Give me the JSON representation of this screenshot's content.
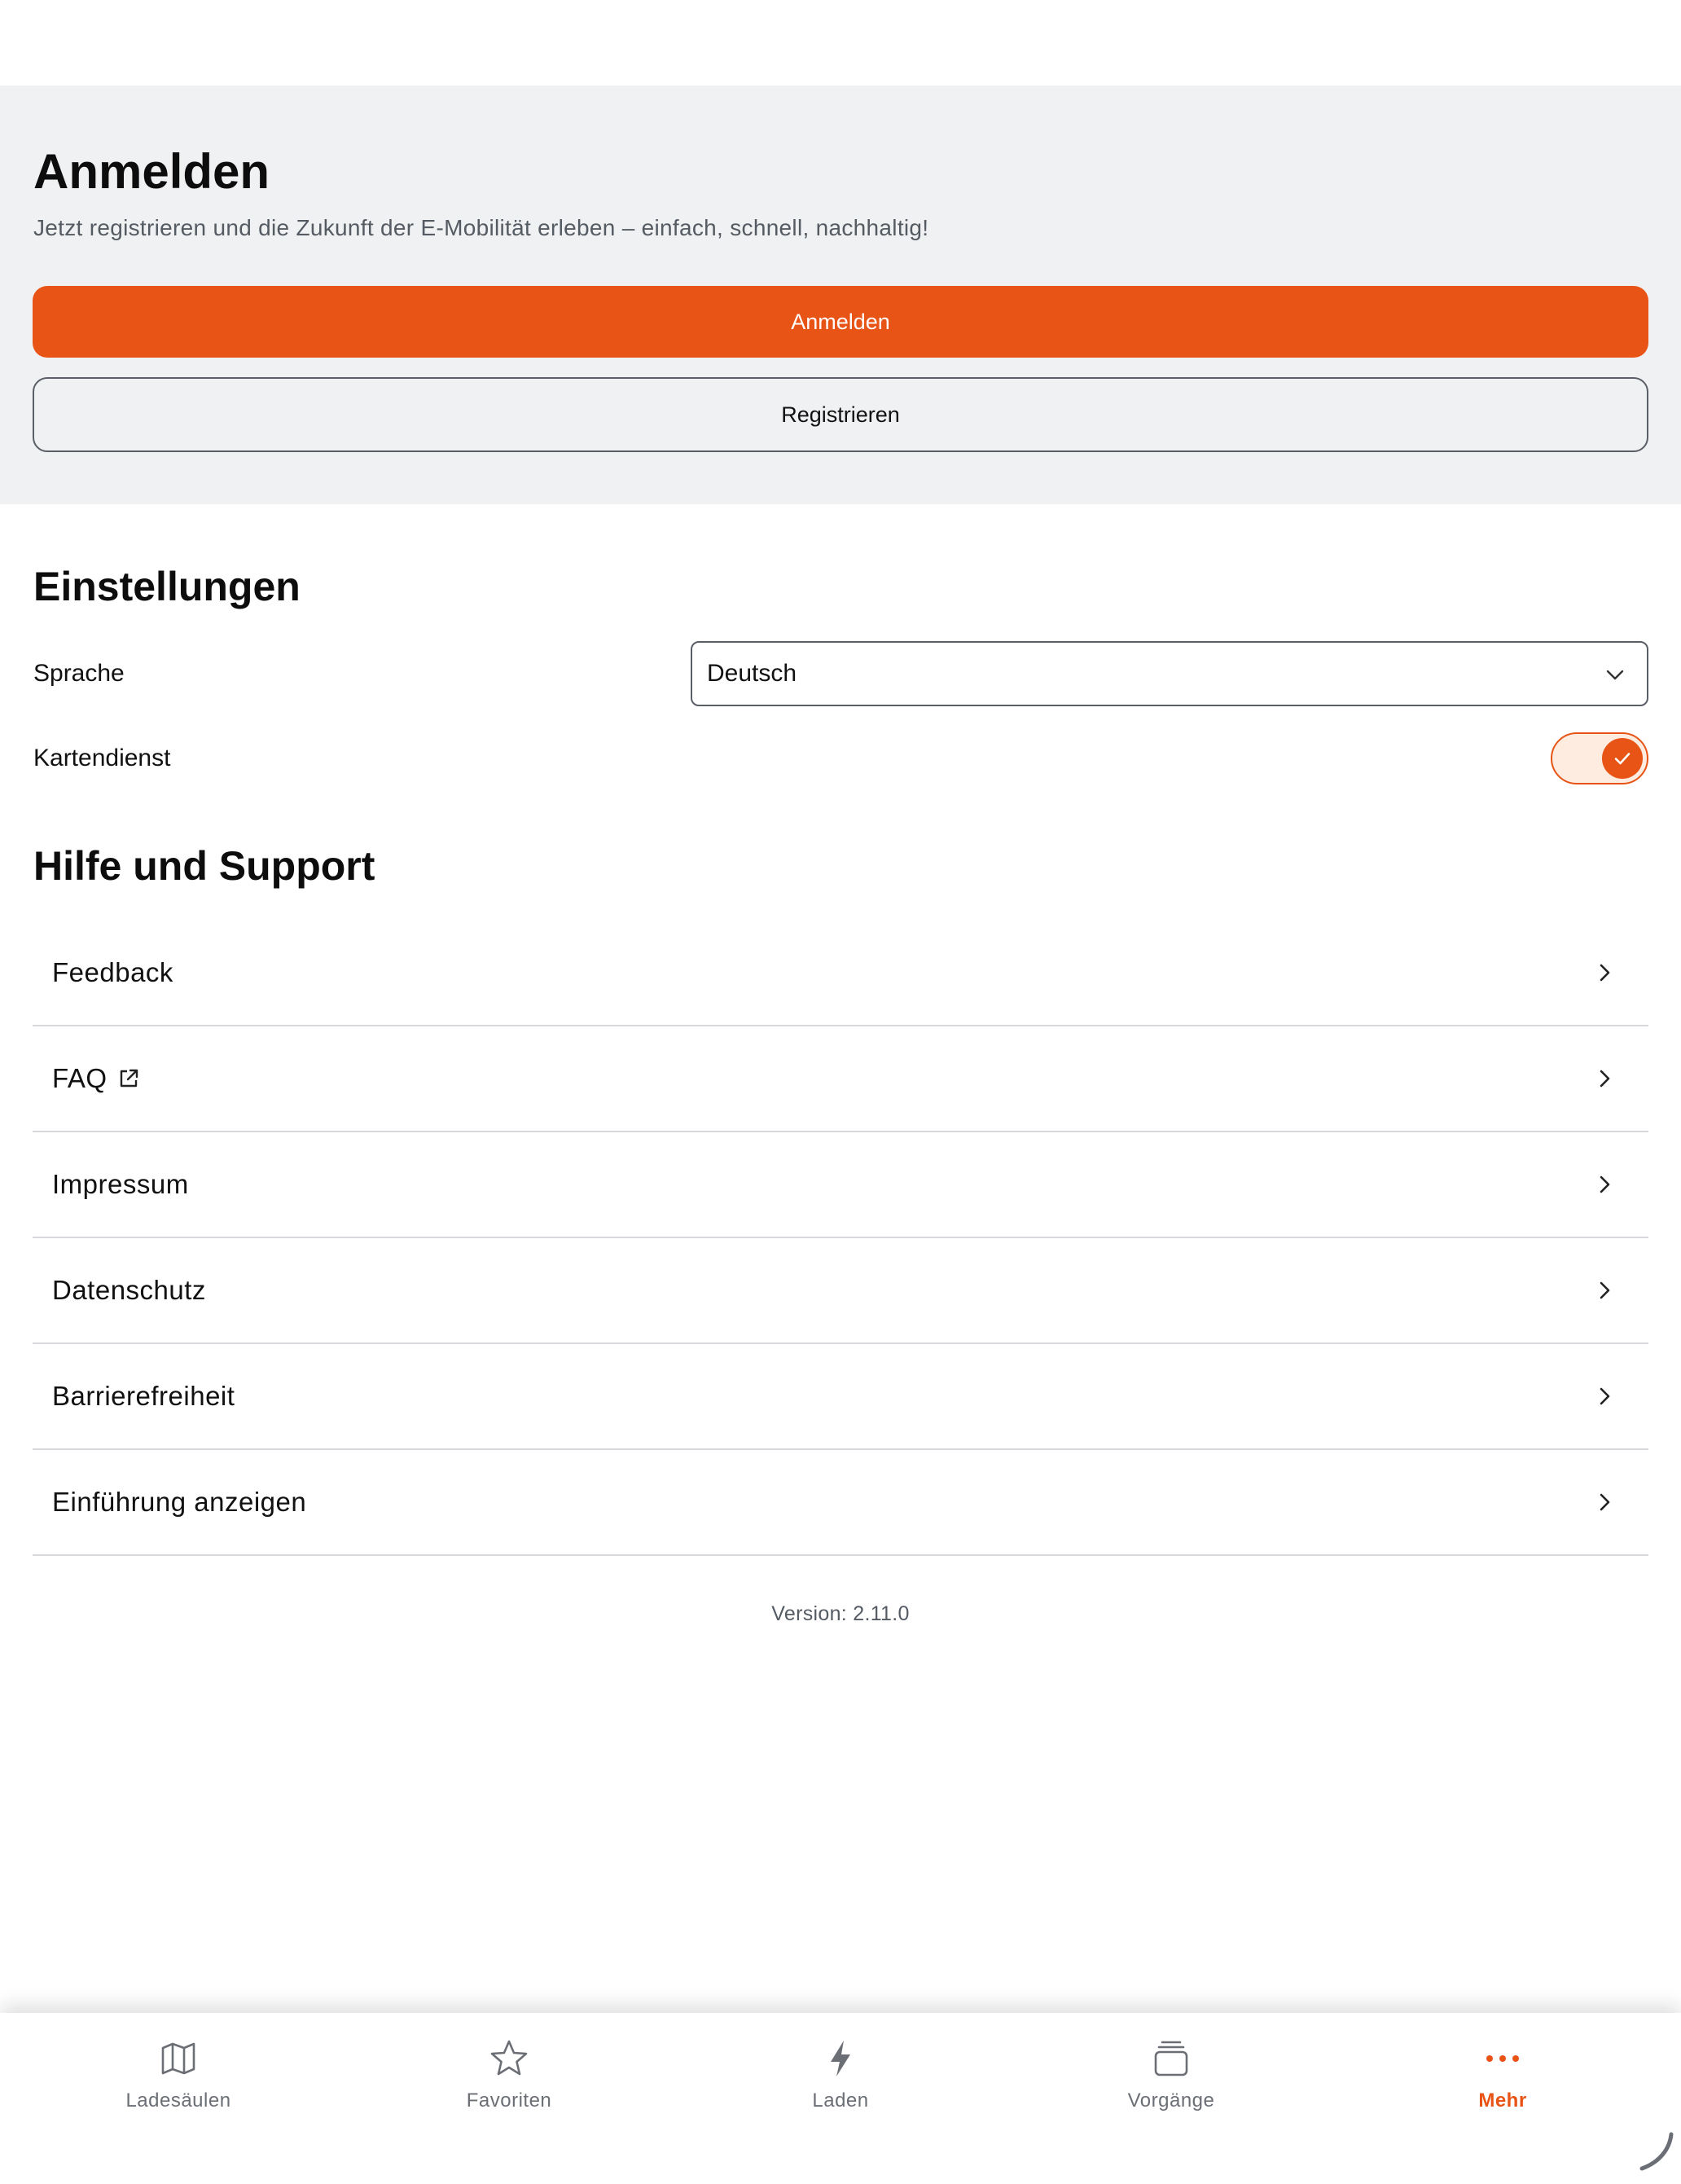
{
  "login": {
    "title": "Anmelden",
    "subtitle": "Jetzt registrieren und die Zukunft der E-Mobilität erleben – einfach, schnell, nachhaltig!",
    "login_button": "Anmelden",
    "register_button": "Registrieren"
  },
  "settings": {
    "title": "Einstellungen",
    "language_label": "Sprache",
    "language_value": "Deutsch",
    "map_service_label": "Kartendienst",
    "map_service_enabled": true
  },
  "help": {
    "title": "Hilfe und Support",
    "items": [
      {
        "label": "Feedback",
        "external": false
      },
      {
        "label": "FAQ",
        "external": true
      },
      {
        "label": "Impressum",
        "external": false
      },
      {
        "label": "Datenschutz",
        "external": false
      },
      {
        "label": "Barrierefreiheit",
        "external": false
      },
      {
        "label": "Einführung anzeigen",
        "external": false
      }
    ]
  },
  "version": "Version: 2.11.0",
  "tabs": [
    {
      "label": "Ladesäulen",
      "icon": "map-icon",
      "active": false
    },
    {
      "label": "Favoriten",
      "icon": "star-icon",
      "active": false
    },
    {
      "label": "Laden",
      "icon": "lightning-icon",
      "active": false
    },
    {
      "label": "Vorgänge",
      "icon": "stack-icon",
      "active": false
    },
    {
      "label": "Mehr",
      "icon": "more-icon",
      "active": true
    }
  ],
  "colors": {
    "accent": "#e85316",
    "section_background": "#f0f1f2",
    "toggle_track": "#fdecdf",
    "muted_text": "#555b63"
  }
}
